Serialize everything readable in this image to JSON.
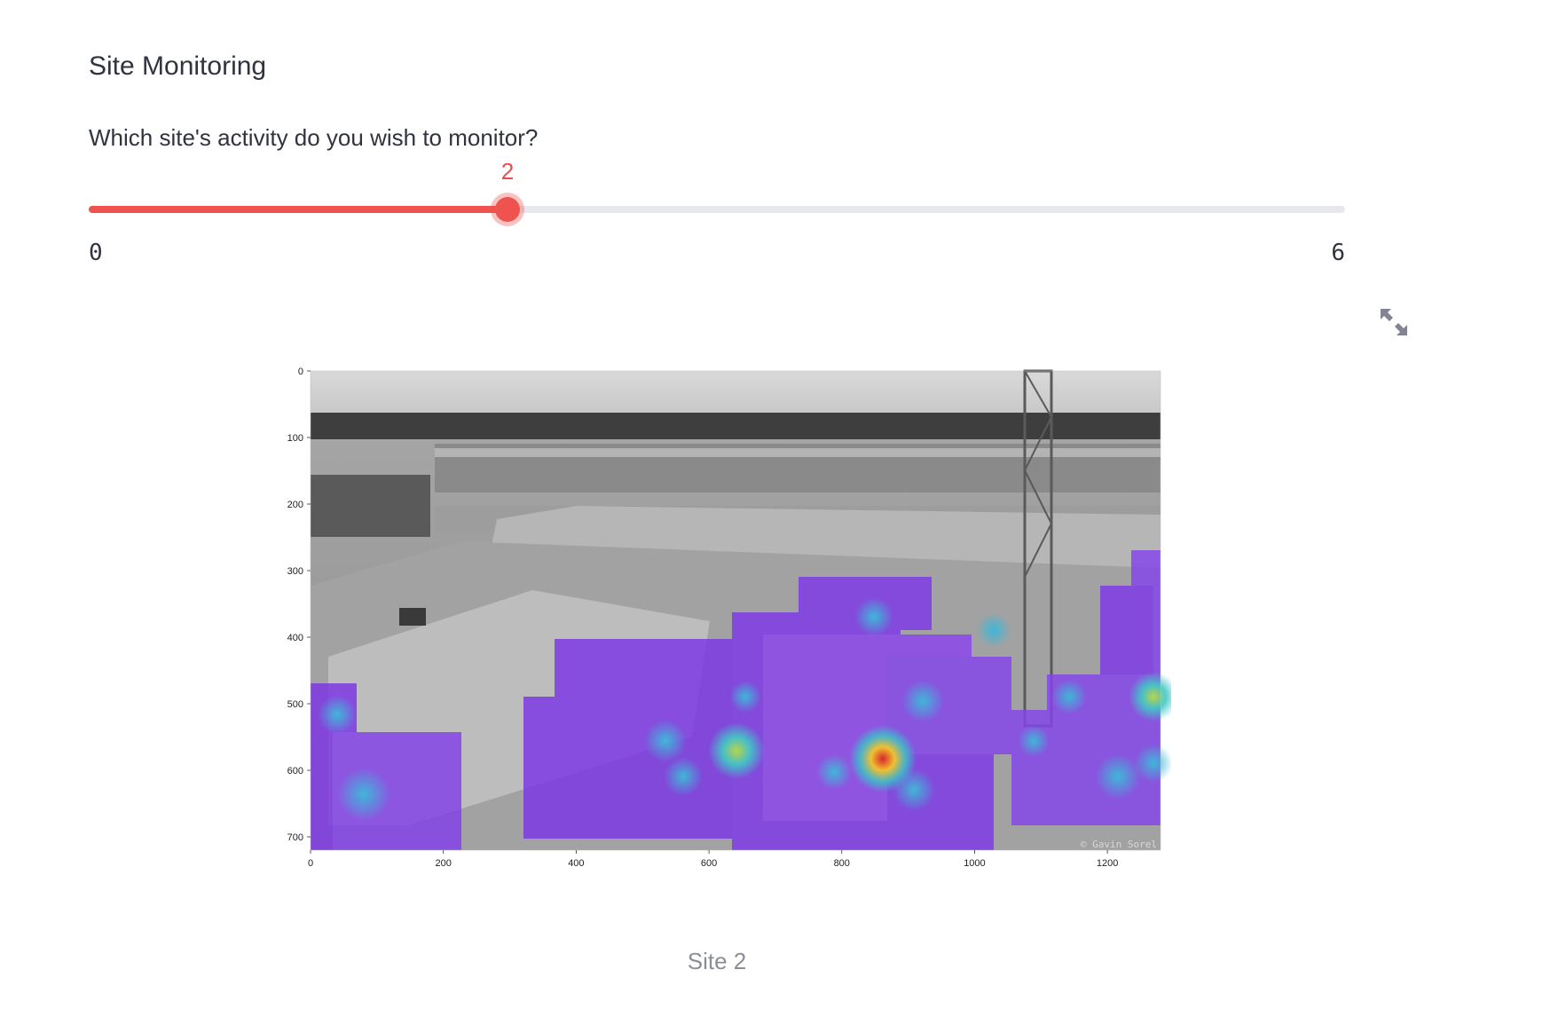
{
  "header": {
    "title": "Site Monitoring"
  },
  "slider": {
    "label": "Which site's activity do you wish to monitor?",
    "min": 0,
    "max": 6,
    "value": 2,
    "min_label": "0",
    "max_label": "6",
    "value_label": "2",
    "accent": "#ef5350"
  },
  "figure": {
    "watermark": "© Gavin Sorel",
    "caption": "Site 2",
    "x_ticks": [
      "0",
      "200",
      "400",
      "600",
      "800",
      "1000",
      "1200"
    ],
    "y_ticks": [
      "0",
      "100",
      "200",
      "300",
      "400",
      "500",
      "600",
      "700"
    ],
    "x_range": [
      0,
      1280
    ],
    "y_range": [
      0,
      720
    ],
    "image": "construction site photo (grayscale) with activity heatmap overlay",
    "heatmap_colormap": "purple-cyan-yellow-red"
  },
  "toolbar": {
    "expand_icon": "fullscreen-expand-icon"
  }
}
